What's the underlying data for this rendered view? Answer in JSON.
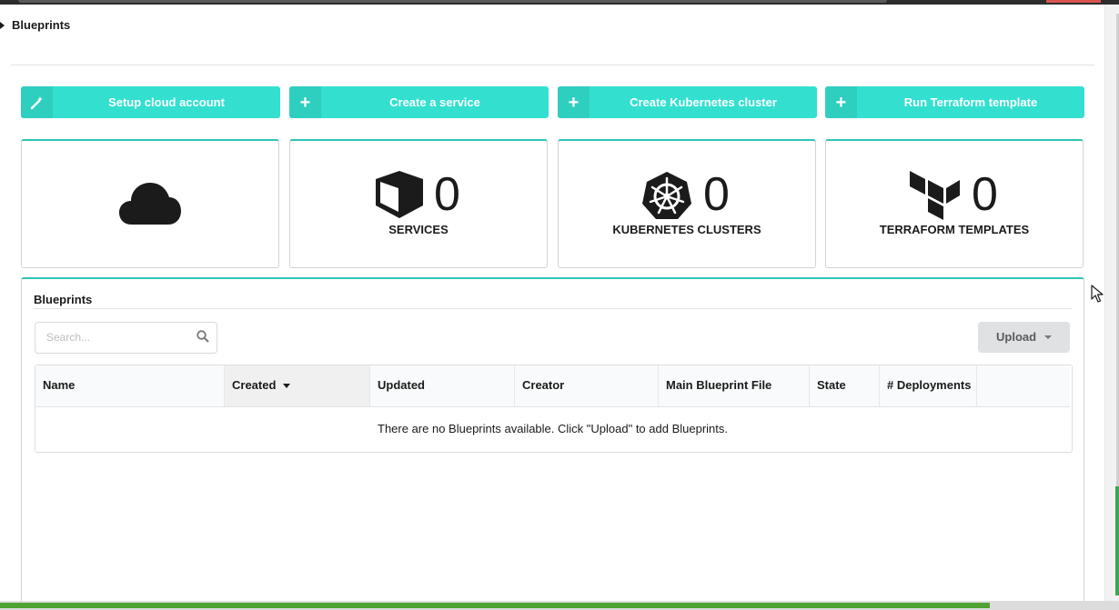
{
  "page": {
    "title": "Blueprints"
  },
  "actions": [
    {
      "label": "Setup cloud account",
      "icon": "magic-wand-icon"
    },
    {
      "label": "Create a service",
      "icon": "plus-icon"
    },
    {
      "label": "Create Kubernetes cluster",
      "icon": "plus-icon"
    },
    {
      "label": "Run Terraform template",
      "icon": "plus-icon"
    }
  ],
  "stats": [
    {
      "icon": "cloud-icon"
    },
    {
      "icon": "cube-icon",
      "count": "0",
      "label": "SERVICES"
    },
    {
      "icon": "kubernetes-icon",
      "count": "0",
      "label": "KUBERNETES CLUSTERS"
    },
    {
      "icon": "terraform-icon",
      "count": "0",
      "label": "TERRAFORM TEMPLATES"
    }
  ],
  "blueprints": {
    "title": "Blueprints",
    "search_placeholder": "Search...",
    "upload_label": "Upload",
    "columns": [
      "Name",
      "Created",
      "Updated",
      "Creator",
      "Main Blueprint File",
      "State",
      "# Deployments"
    ],
    "sorted_column": "Created",
    "empty_message": "There are no Blueprints available. Click \"Upload\" to add Blueprints."
  },
  "colors": {
    "accent": "#33e0d0",
    "accent_dark": "#2fcfbf",
    "card_border_top": "#2ec4b6"
  }
}
